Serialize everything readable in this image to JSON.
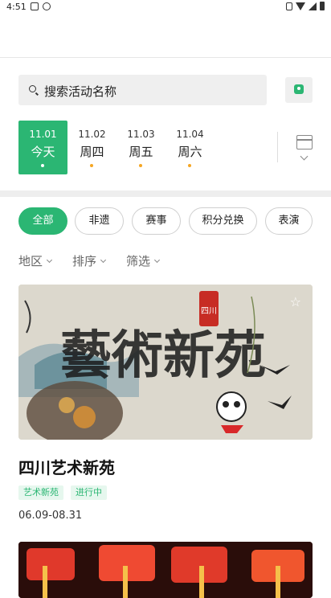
{
  "status_bar": {
    "time": "4:51"
  },
  "search": {
    "placeholder": "搜索活动名称"
  },
  "dates": [
    {
      "date": "11.01",
      "weekday": "今天",
      "active": true
    },
    {
      "date": "11.02",
      "weekday": "周四",
      "active": false
    },
    {
      "date": "11.03",
      "weekday": "周五",
      "active": false
    },
    {
      "date": "11.04",
      "weekday": "周六",
      "active": false
    }
  ],
  "chips": [
    {
      "label": "全部",
      "active": true
    },
    {
      "label": "非遗",
      "active": false
    },
    {
      "label": "赛事",
      "active": false
    },
    {
      "label": "积分兑换",
      "active": false
    },
    {
      "label": "表演",
      "active": false
    }
  ],
  "filters": [
    {
      "label": "地区"
    },
    {
      "label": "排序"
    },
    {
      "label": "筛选"
    }
  ],
  "event": {
    "title": "四川艺术新苑",
    "image_calligraphy": "藝術新苑",
    "image_seal": "四川",
    "tags": [
      "艺术新苑",
      "进行中"
    ],
    "date_range": "06.09-08.31"
  },
  "colors": {
    "accent": "#2bb673",
    "dot": "#f5a623"
  }
}
